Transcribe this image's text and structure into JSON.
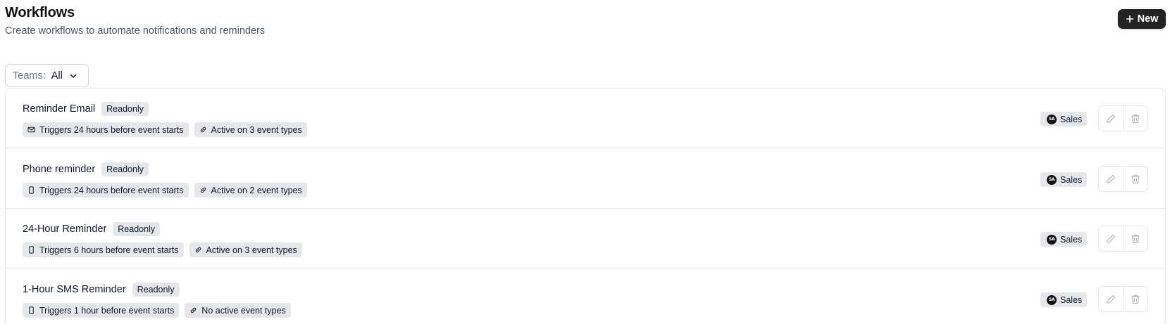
{
  "header": {
    "title": "Workflows",
    "subtitle": "Create workflows to automate notifications and reminders",
    "new_button_label": "New"
  },
  "filter": {
    "label": "Teams:",
    "value": "All"
  },
  "workflows": [
    {
      "name": "Reminder Email",
      "badge": "Readonly",
      "trigger_icon": "mail-icon",
      "trigger": "Triggers 24 hours before event starts",
      "active": "Active on 3 event types",
      "team_initials": "SA",
      "team": "Sales"
    },
    {
      "name": "Phone reminder",
      "badge": "Readonly",
      "trigger_icon": "phone-icon",
      "trigger": "Triggers 24 hours before event starts",
      "active": "Active on 2 event types",
      "team_initials": "SA",
      "team": "Sales"
    },
    {
      "name": "24-Hour Reminder",
      "badge": "Readonly",
      "trigger_icon": "phone-icon",
      "trigger": "Triggers 6 hours before event starts",
      "active": "Active on 3 event types",
      "team_initials": "SA",
      "team": "Sales"
    },
    {
      "name": "1-Hour SMS Reminder",
      "badge": "Readonly",
      "trigger_icon": "phone-icon",
      "trigger": "Triggers 1 hour before event starts",
      "active": "No active event types",
      "team_initials": "SA",
      "team": "Sales"
    }
  ],
  "colors": {
    "primary_button": "#232323",
    "chip_background": "#e5e7eb",
    "border": "#e5e7eb",
    "muted_text": "#6b7280"
  }
}
